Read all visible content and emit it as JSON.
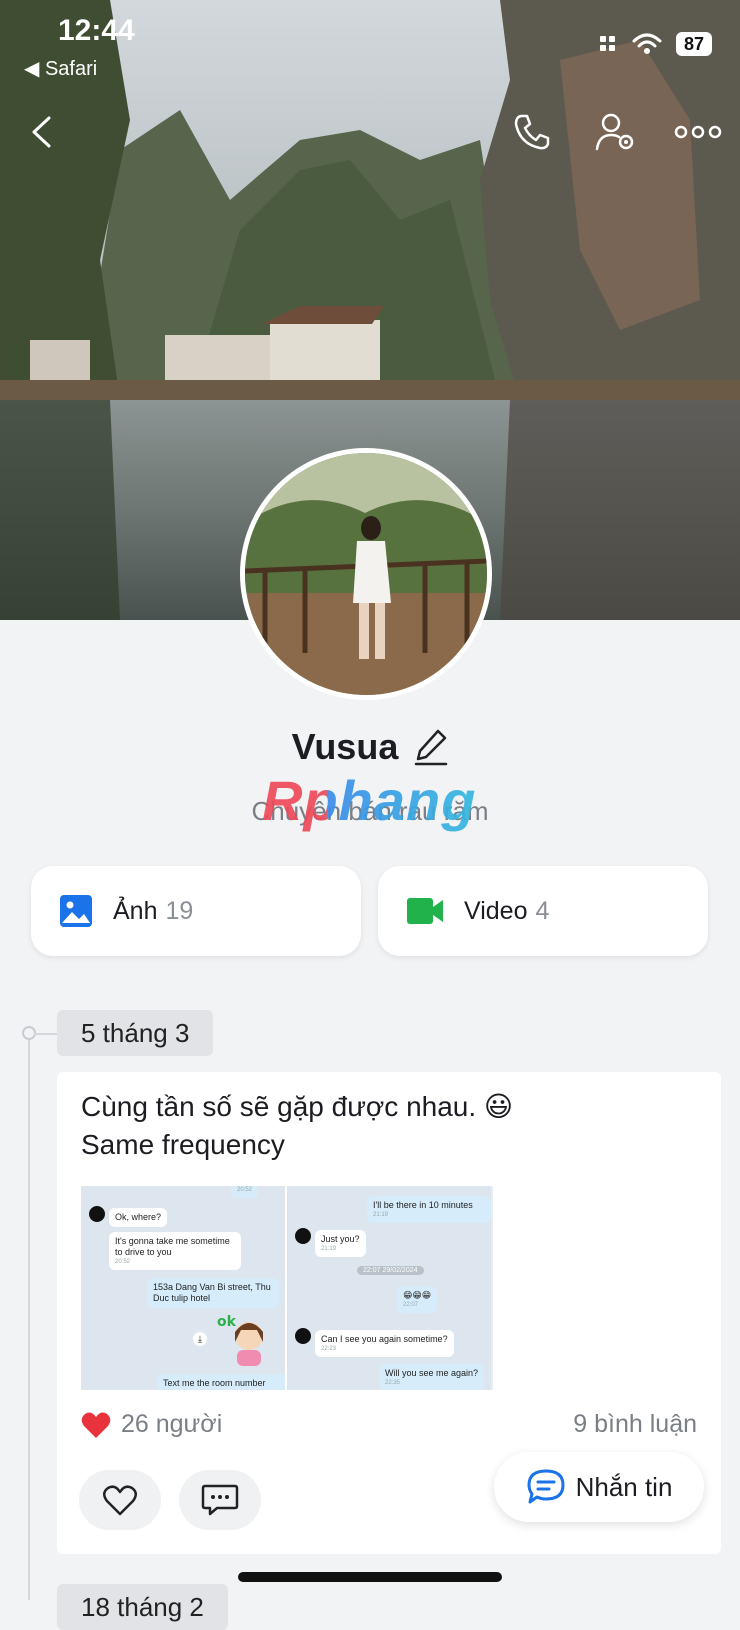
{
  "status_bar": {
    "time": "12:44",
    "back_app": "Safari",
    "battery": "87"
  },
  "profile": {
    "name": "Vusua",
    "bio": "Chuyên bán rau răm",
    "watermark": "Rphang"
  },
  "media": [
    {
      "label": "Ảnh",
      "count": "19",
      "icon": "image-icon",
      "color": "#1a73e8"
    },
    {
      "label": "Video",
      "count": "4",
      "icon": "video-icon",
      "color": "#22b24c"
    }
  ],
  "timeline": {
    "date1": "5 tháng 3",
    "date2": "18 tháng 2"
  },
  "post": {
    "line1": "Cùng tần số sẽ gặp được nhau. 😃",
    "line2": "Same frequency",
    "chat_left": {
      "top_time": "20:52",
      "msg1": "Ok, where?",
      "msg2": "It's gonna take me sometime to drive to you",
      "msg2_time": "20:52",
      "msg3": "153a Dang Van Bi street, Thu Duc tulip hotel",
      "msg4": "Text me the room number"
    },
    "chat_right": {
      "msg1": "I'll be there in 10 minutes",
      "msg1_time": "21:19",
      "msg2": "Just you?",
      "msg2_time": "21:19",
      "date_sep": "22:07 29/02/2024",
      "emoji": "😁😁😁",
      "emoji_time": "22:07",
      "msg3": "Can I see you again sometime?",
      "msg3_time": "22:23",
      "msg4": "Will you see me again?",
      "msg4_time": "22:35"
    },
    "likes": "26 người",
    "comments": "9 bình luận"
  },
  "message_button": "Nhắn tin",
  "colors": {
    "accent": "#1a73e8",
    "heart": "#e8323c",
    "green": "#22b24c"
  }
}
